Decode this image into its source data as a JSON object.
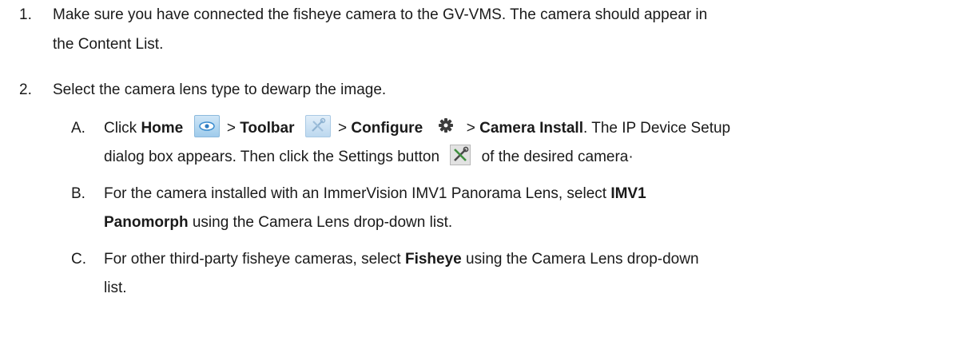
{
  "step1": {
    "number": "1.",
    "line1": "Make sure you have connected the fisheye camera to the GV-VMS. The camera should appear in",
    "line2": "the Content List."
  },
  "step2": {
    "number": "2.",
    "text": "Select the camera lens type to dewarp the image.",
    "substeps": {
      "a": {
        "letter": "A.",
        "click": "Click",
        "home": "Home",
        "sep1": ">",
        "toolbar": "Toolbar",
        "sep2": ">",
        "configure": "Configure",
        "sep3": ">",
        "camera_install": "Camera Install",
        "tail": ". The IP Device Setup",
        "line2_start": "dialog box appears. Then click the Settings button",
        "line2_end": "of the desired camera·"
      },
      "b": {
        "letter": "B.",
        "line1_start": "For the camera installed with an ImmerVision IMV1 Panorama Lens, select",
        "bold1": "IMV1",
        "bold2": "Panomorph",
        "line2_end": "using the Camera Lens drop-down list."
      },
      "c": {
        "letter": "C.",
        "line1_start": "For other third-party fisheye cameras, select",
        "bold": "Fisheye",
        "line1_end": "using the Camera Lens drop-down",
        "line2": "list."
      }
    }
  },
  "icons": {
    "home": "eye-icon",
    "toolbar": "tools-icon",
    "configure": "gear-icon",
    "settings": "settings-tools-icon"
  }
}
